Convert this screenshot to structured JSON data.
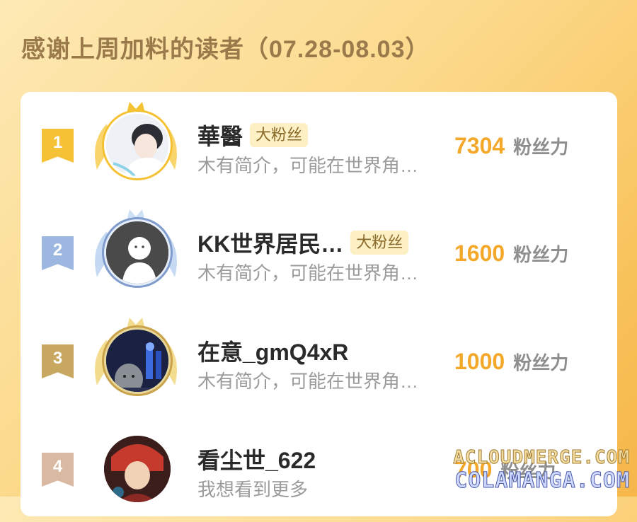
{
  "title": "感谢上周加料的读者（07.28-08.03）",
  "colors": {
    "accent": "#f4a82a",
    "gold": "#f5c236",
    "silver": "#9cb8e0",
    "bronze": "#c8a860",
    "rank4": "#d9b9a2"
  },
  "readers": [
    {
      "rank": "1",
      "name": "華醫",
      "tag": "大粉丝",
      "bio": "木有简介，可能在世界角…",
      "score": "7304",
      "unit": "粉丝力"
    },
    {
      "rank": "2",
      "name": "KK世界居民…",
      "tag": "大粉丝",
      "bio": "木有简介，可能在世界角…",
      "score": "1600",
      "unit": "粉丝力"
    },
    {
      "rank": "3",
      "name": "在意_gmQ4xR",
      "tag": "",
      "bio": "木有简介，可能在世界角…",
      "score": "1000",
      "unit": "粉丝力"
    },
    {
      "rank": "4",
      "name": "看尘世_622",
      "tag": "",
      "bio": "我想看到更多",
      "score": "700",
      "unit": "粉丝力"
    }
  ],
  "watermark": {
    "line1": "ACLOUDMERGE.COM",
    "line2": "COLAMANGA.COM"
  }
}
